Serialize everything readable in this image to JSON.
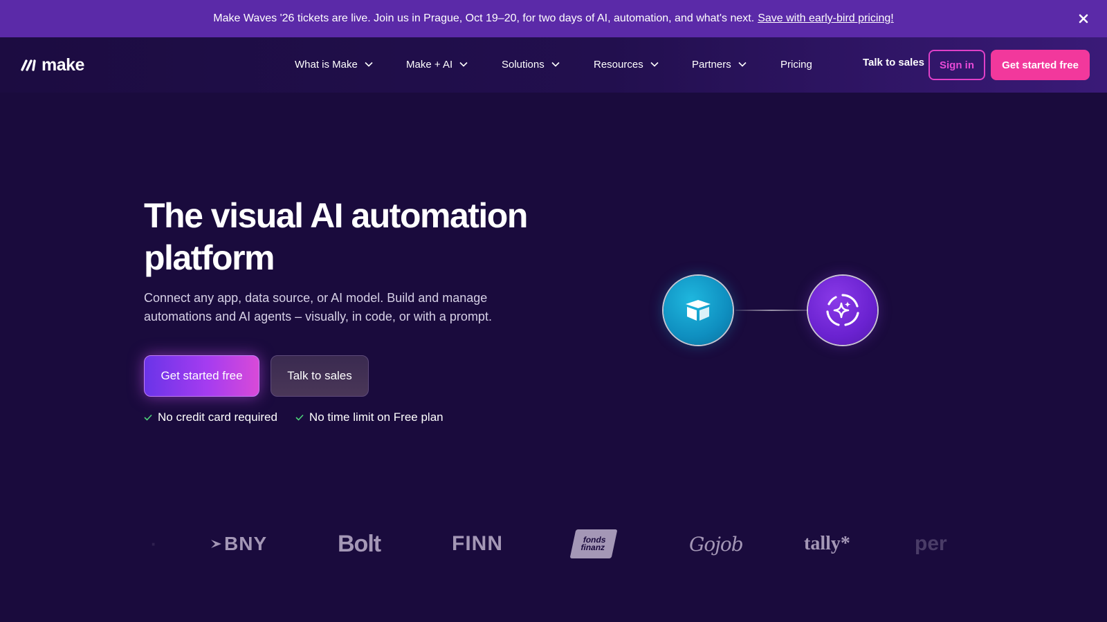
{
  "banner": {
    "text": "Make Waves '26 tickets are live. Join us in Prague, Oct 19–20, for two days of AI, automation, and what's next.",
    "link": "Save with early-bird pricing!"
  },
  "nav": {
    "logo_text": "make",
    "items": [
      {
        "label": "What is Make"
      },
      {
        "label": "Make + AI"
      },
      {
        "label": "Solutions"
      },
      {
        "label": "Resources"
      },
      {
        "label": "Partners"
      },
      {
        "label": "Pricing"
      }
    ],
    "talk_to_sales": "Talk to sales",
    "sign_in": "Sign in",
    "get_started": "Get started free"
  },
  "hero": {
    "title": "The visual AI automation platform",
    "subtitle": "Connect any app, data source, or AI model. Build and manage automations and AI agents – visually, in code, or with a prompt.",
    "cta_primary": "Get started free",
    "cta_secondary": "Talk to sales",
    "perks": [
      "No credit card required",
      "No time limit on Free plan"
    ]
  },
  "logos": [
    "BNY",
    "Bolt",
    "FINN",
    "fonds finanz",
    "Gojob",
    "tally*",
    "per"
  ],
  "colors": {
    "background": "#1a0b3d",
    "banner": "#5b2aa8",
    "accent_pink": "#f2389c",
    "sign_in_border": "#e040c8",
    "check": "#4cd47a"
  }
}
